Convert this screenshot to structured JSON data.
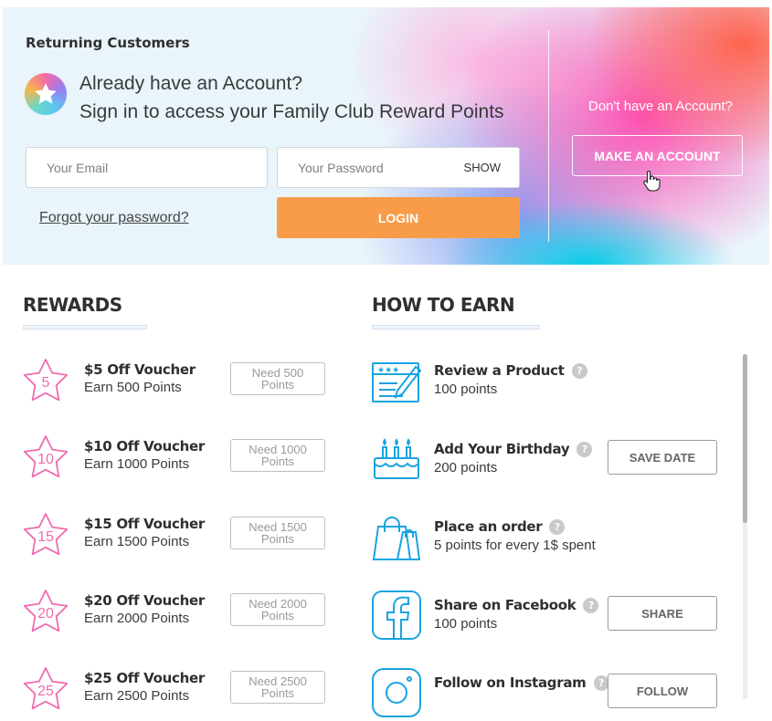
{
  "login": {
    "heading": "Returning Customers",
    "lead_line1": "Already have an Account?",
    "lead_line2": "Sign in to access your Family Club Reward Points",
    "email_placeholder": "Your Email",
    "password_placeholder": "Your Password",
    "show_label": "SHOW",
    "forgot_label": "Forgot your password?",
    "login_label": "LOGIN",
    "login_color": "#f89c49"
  },
  "signup": {
    "prompt": "Don't have an Account?",
    "button_label": "MAKE AN ACCOUNT"
  },
  "rewards": {
    "heading": "REWARDS",
    "items": [
      {
        "badge": "5",
        "title": "$5 Off Voucher",
        "subtitle": "Earn 500 Points",
        "need_line1": "Need 500",
        "need_line2": "Points"
      },
      {
        "badge": "10",
        "title": "$10 Off Voucher",
        "subtitle": "Earn 1000 Points",
        "need_line1": "Need 1000",
        "need_line2": "Points"
      },
      {
        "badge": "15",
        "title": "$15 Off Voucher",
        "subtitle": "Earn 1500 Points",
        "need_line1": "Need 1500",
        "need_line2": "Points"
      },
      {
        "badge": "20",
        "title": "$20 Off Voucher",
        "subtitle": "Earn 2000 Points",
        "need_line1": "Need 2000",
        "need_line2": "Points"
      },
      {
        "badge": "25",
        "title": "$25 Off Voucher",
        "subtitle": "Earn 2500 Points",
        "need_line1": "Need 2500",
        "need_line2": "Points"
      }
    ],
    "star_color": "#f06ab0"
  },
  "earn": {
    "heading": "HOW TO EARN",
    "icon_color": "#1aa3e0",
    "items": [
      {
        "icon": "review-icon",
        "title": "Review a Product",
        "subtitle": "100 points",
        "button": ""
      },
      {
        "icon": "birthday-cake-icon",
        "title": "Add Your Birthday",
        "subtitle": "200 points",
        "button": "SAVE DATE"
      },
      {
        "icon": "shopping-bag-icon",
        "title": "Place an order",
        "subtitle": "5 points for every 1$ spent",
        "button": ""
      },
      {
        "icon": "facebook-icon",
        "title": "Share on Facebook",
        "subtitle": "100 points",
        "button": "SHARE"
      },
      {
        "icon": "instagram-icon",
        "title": "Follow on Instagram",
        "subtitle": "",
        "button": "FOLLOW"
      }
    ],
    "help_glyph": "?"
  }
}
